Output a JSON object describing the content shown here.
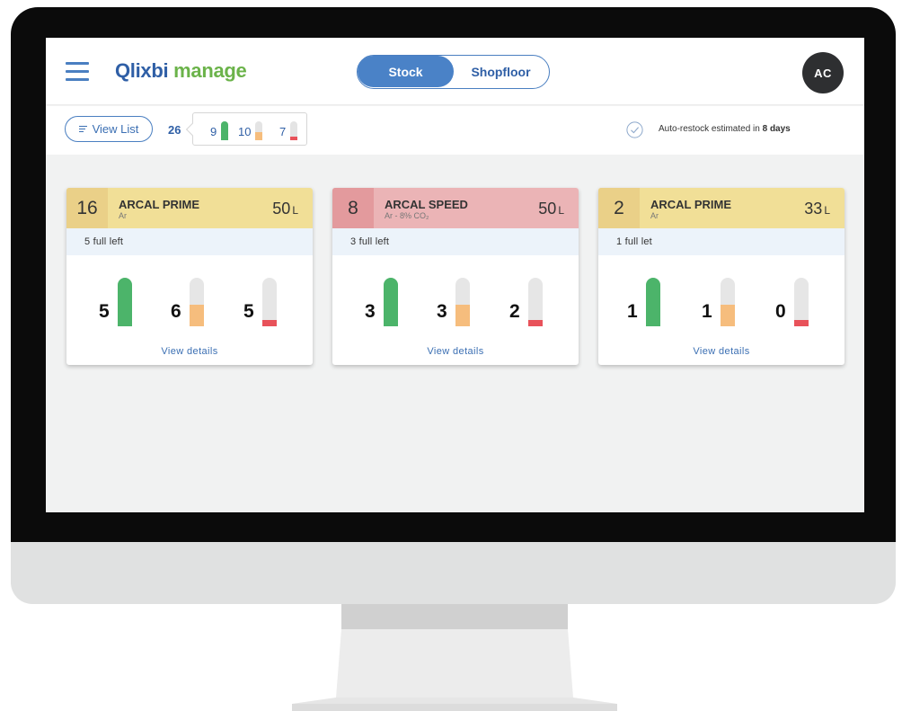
{
  "colors": {
    "accent_blue": "#4a82c7",
    "logo_blue": "#2f5fa6",
    "logo_green": "#6bb34a",
    "full": "#4cb46a",
    "partial": "#f6bd7d",
    "empty": "#e8525a",
    "header_yellow": "#f1df97",
    "header_yellow_count": "#ead088",
    "header_red": "#ebb4b6",
    "header_red_count": "#e39a9d"
  },
  "header": {
    "menu_icon": "hamburger-icon",
    "logo_part1": "Qlixbi",
    "logo_part2": "manage",
    "tabs": [
      {
        "label": "Stock",
        "active": true
      },
      {
        "label": "Shopfloor",
        "active": false
      }
    ],
    "avatar_initials": "AC"
  },
  "toolbar": {
    "view_list_label": "View List",
    "total": "26",
    "summary": [
      {
        "count": "9",
        "level": 1.0,
        "status": "full"
      },
      {
        "count": "10",
        "level": 0.45,
        "status": "partial"
      },
      {
        "count": "7",
        "level": 0.18,
        "status": "empty"
      }
    ],
    "restock_prefix": "Auto-restock estimated in ",
    "restock_value": "8 days"
  },
  "cards": [
    {
      "count": "16",
      "name": "ARCAL PRIME",
      "gas": "Ar",
      "volume": "50",
      "unit": "L",
      "theme": "yellow",
      "full_left": "5 full left",
      "tubes": [
        {
          "count": "5",
          "level": 1.0,
          "status": "full"
        },
        {
          "count": "6",
          "level": 0.45,
          "status": "partial"
        },
        {
          "count": "5",
          "level": 0.13,
          "status": "empty"
        }
      ],
      "action": "View details"
    },
    {
      "count": "8",
      "name": "ARCAL SPEED",
      "gas": "Ar - 8% CO₂",
      "volume": "50",
      "unit": "L",
      "theme": "red",
      "full_left": "3 full left",
      "tubes": [
        {
          "count": "3",
          "level": 1.0,
          "status": "full"
        },
        {
          "count": "3",
          "level": 0.45,
          "status": "partial"
        },
        {
          "count": "2",
          "level": 0.13,
          "status": "empty"
        }
      ],
      "action": "View details"
    },
    {
      "count": "2",
      "name": "ARCAL PRIME",
      "gas": "Ar",
      "volume": "33",
      "unit": "L",
      "theme": "yellow",
      "full_left": "1 full let",
      "tubes": [
        {
          "count": "1",
          "level": 1.0,
          "status": "full"
        },
        {
          "count": "1",
          "level": 0.45,
          "status": "partial"
        },
        {
          "count": "0",
          "level": 0.13,
          "status": "empty"
        }
      ],
      "action": "View details"
    }
  ]
}
